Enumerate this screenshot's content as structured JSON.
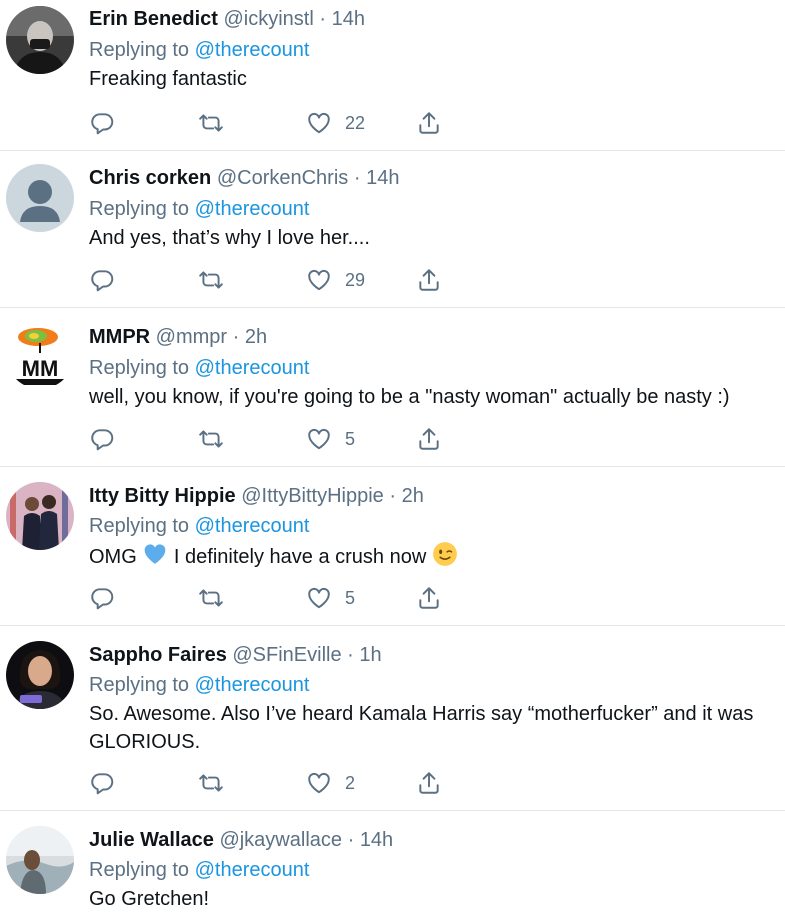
{
  "tweets": [
    {
      "name": "Erin Benedict",
      "handle": "@ickyinstl",
      "sep": "·",
      "time": "14h",
      "reply_prefix": "Replying to",
      "reply_to": "@therecount",
      "text": "Freaking fantastic",
      "likes": "22",
      "avatar": "photo-avatar"
    },
    {
      "name": "Chris corken",
      "handle": "@CorkenChris",
      "sep": "·",
      "time": "14h",
      "reply_prefix": "Replying to",
      "reply_to": "@therecount",
      "text": "And yes, that’s why I love her....",
      "likes": "29",
      "avatar": "default-avatar"
    },
    {
      "name": "MMPR",
      "handle": "@mmpr",
      "sep": "·",
      "time": "2h",
      "reply_prefix": "Replying to",
      "reply_to": "@therecount",
      "text": "well, you know, if you're going to be a \"nasty woman\" actually be nasty :)",
      "likes": "5",
      "avatar": "mmpr-logo-avatar",
      "avatar_text": "MM"
    },
    {
      "name": "Itty Bitty Hippie",
      "handle": "@IttyBittyHippie",
      "sep": "·",
      "time": "2h",
      "reply_prefix": "Replying to",
      "reply_to": "@therecount",
      "text_before": "OMG",
      "text_middle": "I definitely have a crush now",
      "likes": "5",
      "avatar": "photo-avatar",
      "emoji": [
        "blue-heart-emoji",
        "winking-face-emoji"
      ]
    },
    {
      "name": "Sappho Faires",
      "handle": "@SFinEville",
      "sep": "·",
      "time": "1h",
      "reply_prefix": "Replying to",
      "reply_to": "@therecount",
      "text": "So. Awesome. Also I’ve heard Kamala Harris say “motherfucker” and it was GLORIOUS.",
      "likes": "2",
      "avatar": "photo-avatar"
    },
    {
      "name": "Julie Wallace",
      "handle": "@jkaywallace",
      "sep": "·",
      "time": "14h",
      "reply_prefix": "Replying to",
      "reply_to": "@therecount",
      "text": "Go Gretchen!",
      "avatar": "photo-avatar"
    }
  ],
  "icons": {
    "reply": "reply-icon",
    "retweet": "retweet-icon",
    "like": "like-heart-icon",
    "share": "share-icon"
  },
  "colors": {
    "name": "#0f1419",
    "secondary": "#5b7083",
    "mention": "#1b95e0",
    "divider": "#e1e8ed",
    "blue_heart": "#5dadec",
    "emoji_yellow": "#ffcc4d"
  }
}
